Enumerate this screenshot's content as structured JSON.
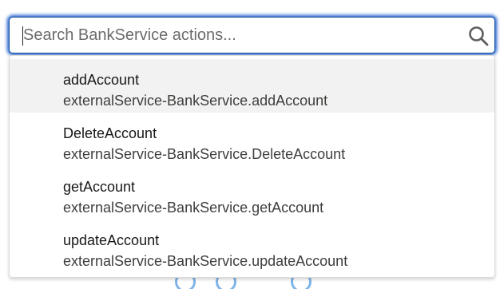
{
  "search": {
    "placeholder": "Search BankService actions...",
    "value": ""
  },
  "icons": {
    "search": "search-icon"
  },
  "colors": {
    "focus_border": "#1b5297",
    "focus_glow": "#1b5ccf",
    "active_row": "#f3f2f2"
  },
  "dropdown": {
    "options": [
      {
        "title": "addAccount",
        "subtitle": "externalService-BankService.addAccount"
      },
      {
        "title": "DeleteAccount",
        "subtitle": "externalService-BankService.DeleteAccount"
      },
      {
        "title": "getAccount",
        "subtitle": "externalService-BankService.getAccount"
      },
      {
        "title": "updateAccount",
        "subtitle": "externalService-BankService.updateAccount"
      }
    ]
  }
}
